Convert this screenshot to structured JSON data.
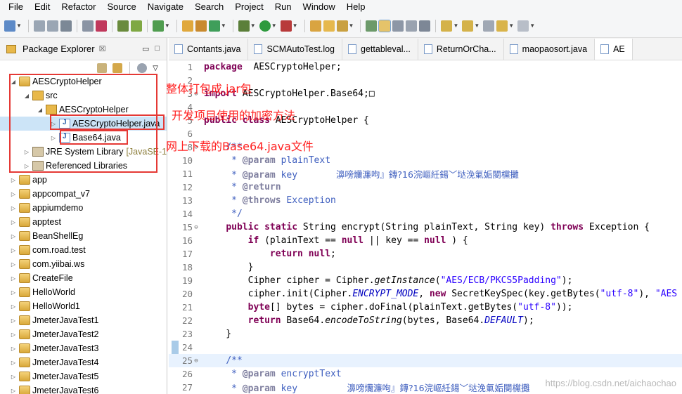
{
  "menu": [
    "File",
    "Edit",
    "Refactor",
    "Source",
    "Navigate",
    "Search",
    "Project",
    "Run",
    "Window",
    "Help"
  ],
  "package_explorer": {
    "title": "Package Explorer",
    "close": "☒",
    "tree": [
      {
        "label": "AESCryptoHelper",
        "level": 0,
        "arrow": "◢",
        "icon": "project-icon"
      },
      {
        "label": "src",
        "level": 1,
        "arrow": "◢",
        "icon": "source-folder-icon"
      },
      {
        "label": "AESCryptoHelper",
        "level": 2,
        "arrow": "◢",
        "icon": "package-icon"
      },
      {
        "label": "AESCryptoHelper.java",
        "level": 3,
        "arrow": "▷",
        "icon": "java-file-icon"
      },
      {
        "label": "Base64.java",
        "level": 3,
        "arrow": "▷",
        "icon": "java-file-icon"
      },
      {
        "label": "JRE System Library",
        "suffix": "[JavaSE-1",
        "level": 1,
        "arrow": "▷",
        "icon": "library-icon"
      },
      {
        "label": "Referenced Libraries",
        "level": 1,
        "arrow": "▷",
        "icon": "library-icon"
      },
      {
        "label": "app",
        "level": 0,
        "arrow": "▷",
        "icon": "project-icon"
      },
      {
        "label": "appcompat_v7",
        "level": 0,
        "arrow": "▷",
        "icon": "project-icon"
      },
      {
        "label": "appiumdemo",
        "level": 0,
        "arrow": "▷",
        "icon": "project-icon"
      },
      {
        "label": "apptest",
        "level": 0,
        "arrow": "▷",
        "icon": "project-icon"
      },
      {
        "label": "BeanShellEg",
        "level": 0,
        "arrow": "▷",
        "icon": "project-icon"
      },
      {
        "label": "com.road.test",
        "level": 0,
        "arrow": "▷",
        "icon": "project-icon"
      },
      {
        "label": "com.yiibai.ws",
        "level": 0,
        "arrow": "▷",
        "icon": "project-icon"
      },
      {
        "label": "CreateFile",
        "level": 0,
        "arrow": "▷",
        "icon": "project-icon"
      },
      {
        "label": "HelloWorld",
        "level": 0,
        "arrow": "▷",
        "icon": "project-icon"
      },
      {
        "label": "HelloWorld1",
        "level": 0,
        "arrow": "▷",
        "icon": "project-icon"
      },
      {
        "label": "JmeterJavaTest1",
        "level": 0,
        "arrow": "▷",
        "icon": "project-icon"
      },
      {
        "label": "JmeterJavaTest2",
        "level": 0,
        "arrow": "▷",
        "icon": "project-icon"
      },
      {
        "label": "JmeterJavaTest3",
        "level": 0,
        "arrow": "▷",
        "icon": "project-icon"
      },
      {
        "label": "JmeterJavaTest4",
        "level": 0,
        "arrow": "▷",
        "icon": "project-icon"
      },
      {
        "label": "JmeterJavaTest5",
        "level": 0,
        "arrow": "▷",
        "icon": "project-icon"
      },
      {
        "label": "JmeterJavaTest6",
        "level": 0,
        "arrow": "▷",
        "icon": "project-icon"
      }
    ]
  },
  "annotations": {
    "jar": "整体打包成.jar包",
    "method": "开发项目使用的加密方法",
    "download": "网上下载的Base64.java文件"
  },
  "editor_tabs": [
    {
      "label": "Contants.java",
      "active": false
    },
    {
      "label": "SCMAutoTest.log",
      "active": false
    },
    {
      "label": "gettableval...",
      "active": false
    },
    {
      "label": "ReturnOrCha...",
      "active": false
    },
    {
      "label": "maopaosort.java",
      "active": false
    },
    {
      "label": "AE",
      "active": true
    }
  ],
  "code_lines": [
    {
      "num": "1",
      "fold": "",
      "segs": [
        [
          "kw",
          "package"
        ],
        [
          "",
          "  AESCryptoHelper;"
        ]
      ]
    },
    {
      "num": "2",
      "fold": "",
      "segs": []
    },
    {
      "num": "3",
      "fold": "⊕",
      "segs": [
        [
          "kw",
          "import"
        ],
        [
          "",
          " AESCryptoHelper.Base64;"
        ],
        [
          "",
          "□"
        ]
      ]
    },
    {
      "num": "4",
      "fold": "",
      "segs": []
    },
    {
      "num": "5",
      "fold": "",
      "segs": [
        [
          "kw",
          "public"
        ],
        [
          "",
          " "
        ],
        [
          "kw",
          "class"
        ],
        [
          "",
          " AESCryptoHelper {"
        ]
      ]
    },
    {
      "num": "6",
      "fold": "",
      "segs": []
    },
    {
      "num": "8",
      "fold": "⊖",
      "segs": [
        [
          "",
          "    "
        ],
        [
          "cm",
          "/**"
        ]
      ]
    },
    {
      "num": "10",
      "fold": "",
      "segs": [
        [
          "cm",
          "     * "
        ],
        [
          "tag",
          "@param"
        ],
        [
          "cm",
          " plainText"
        ]
      ]
    },
    {
      "num": "11",
      "fold": "",
      "segs": [
        [
          "cm",
          "     * "
        ],
        [
          "tag",
          "@param"
        ],
        [
          "cm",
          " key       "
        ],
        [
          "garb",
          "濞嗙爤濂呴』鏄?16浣嶇紝鍚﹀垯浼氭姤閿欓攤"
        ]
      ]
    },
    {
      "num": "12",
      "fold": "",
      "segs": [
        [
          "cm",
          "     * "
        ],
        [
          "tag",
          "@return"
        ]
      ]
    },
    {
      "num": "13",
      "fold": "",
      "segs": [
        [
          "cm",
          "     * "
        ],
        [
          "tag",
          "@throws"
        ],
        [
          "cm",
          " Exception"
        ]
      ]
    },
    {
      "num": "14",
      "fold": "",
      "segs": [
        [
          "cm",
          "     */"
        ]
      ]
    },
    {
      "num": "15",
      "fold": "⊖",
      "segs": [
        [
          "",
          "    "
        ],
        [
          "kw",
          "public static"
        ],
        [
          "",
          " String encrypt(String plainText, String key) "
        ],
        [
          "kw",
          "throws"
        ],
        [
          "",
          " Exception {"
        ]
      ]
    },
    {
      "num": "16",
      "fold": "",
      "segs": [
        [
          "",
          "        "
        ],
        [
          "kw",
          "if"
        ],
        [
          "",
          " (plainText == "
        ],
        [
          "kw",
          "null"
        ],
        [
          "",
          " || key == "
        ],
        [
          "kw",
          "null"
        ],
        [
          "",
          " ) {"
        ]
      ]
    },
    {
      "num": "17",
      "fold": "",
      "segs": [
        [
          "",
          "            "
        ],
        [
          "kw",
          "return null"
        ],
        [
          "",
          ";"
        ]
      ]
    },
    {
      "num": "18",
      "fold": "",
      "segs": [
        [
          "",
          "        }"
        ]
      ]
    },
    {
      "num": "19",
      "fold": "",
      "segs": [
        [
          "",
          "        Cipher cipher = Cipher."
        ],
        [
          "it",
          "getInstance"
        ],
        [
          "",
          "("
        ],
        [
          "str",
          "\"AES/ECB/PKCS5Padding\""
        ],
        [
          "",
          ");"
        ]
      ]
    },
    {
      "num": "20",
      "fold": "",
      "segs": [
        [
          "",
          "        cipher.init(Cipher."
        ],
        [
          "fld it",
          "ENCRYPT_MODE"
        ],
        [
          "",
          ", "
        ],
        [
          "kw",
          "new"
        ],
        [
          "",
          " SecretKeySpec(key.getBytes("
        ],
        [
          "str",
          "\"utf-8\""
        ],
        [
          "",
          "), "
        ],
        [
          "str",
          "\"AES"
        ]
      ]
    },
    {
      "num": "21",
      "fold": "",
      "segs": [
        [
          "",
          "        "
        ],
        [
          "kw",
          "byte"
        ],
        [
          "",
          "[] bytes = cipher.doFinal(plainText.getBytes("
        ],
        [
          "str",
          "\"utf-8\""
        ],
        [
          "",
          "));"
        ]
      ]
    },
    {
      "num": "22",
      "fold": "",
      "segs": [
        [
          "",
          "        "
        ],
        [
          "kw",
          "return"
        ],
        [
          "",
          " Base64."
        ],
        [
          "it",
          "encodeToString"
        ],
        [
          "",
          "(bytes, Base64."
        ],
        [
          "fld it",
          "DEFAULT"
        ],
        [
          "",
          ");"
        ]
      ]
    },
    {
      "num": "23",
      "fold": "",
      "segs": [
        [
          "",
          "    }"
        ]
      ]
    },
    {
      "num": "24",
      "fold": "",
      "segs": []
    },
    {
      "num": "25",
      "fold": "⊖",
      "segs": [
        [
          "",
          "    "
        ],
        [
          "cm",
          "/**"
        ]
      ],
      "hl": true
    },
    {
      "num": "26",
      "fold": "",
      "segs": [
        [
          "cm",
          "     * "
        ],
        [
          "tag",
          "@param"
        ],
        [
          "cm",
          " encryptText"
        ]
      ]
    },
    {
      "num": "27",
      "fold": "",
      "segs": [
        [
          "cm",
          "     * "
        ],
        [
          "tag",
          "@param"
        ],
        [
          "cm",
          " key         "
        ],
        [
          "garb",
          "濞嗙爤濂呴』鏄?16浣嶇紝鍚﹀垯浼氭姤閿欓攤"
        ]
      ]
    },
    {
      "num": "28",
      "fold": "",
      "segs": [
        [
          "cm",
          "     * "
        ],
        [
          "tag",
          "@return"
        ]
      ]
    }
  ],
  "watermark": "https://blog.csdn.net/aichaochao"
}
